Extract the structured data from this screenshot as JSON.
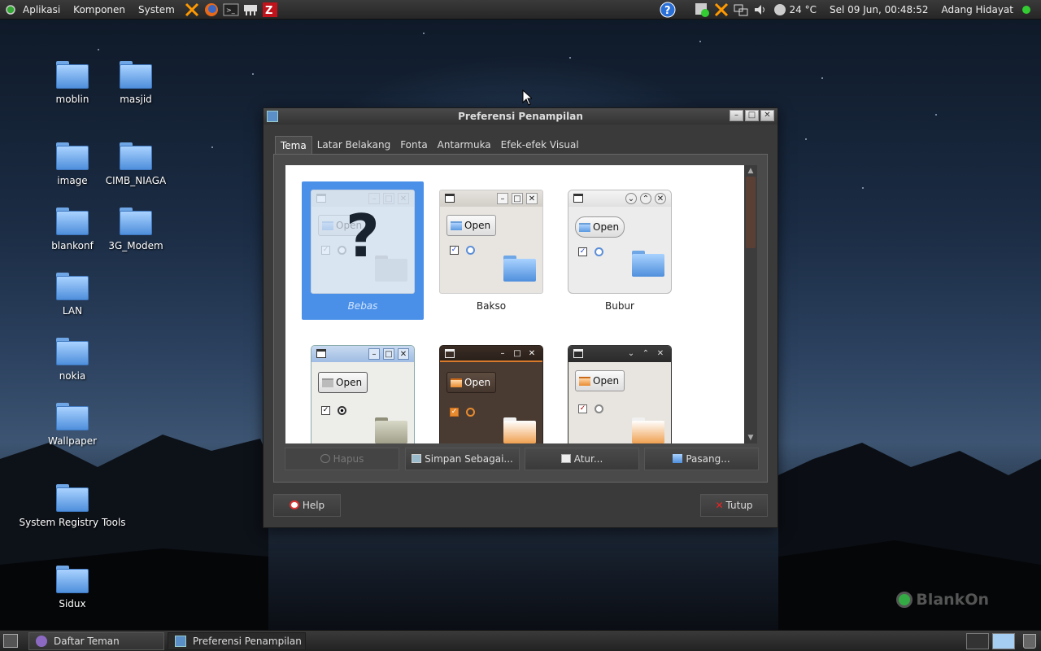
{
  "top_panel": {
    "menu": [
      "Aplikasi",
      "Komponen",
      "System"
    ],
    "launchers": [
      "tools-icon",
      "firefox-icon",
      "terminal-icon",
      "network-icon",
      "filezilla-icon"
    ],
    "temperature": "24 °C",
    "datetime": "Sel 09 Jun, 00:48:52",
    "user": "Adang Hidayat"
  },
  "desktop_icons": [
    {
      "label": "moblin"
    },
    {
      "label": "masjid"
    },
    {
      "label": "image"
    },
    {
      "label": "CIMB_NIAGA"
    },
    {
      "label": "blankonf"
    },
    {
      "label": "3G_Modem"
    },
    {
      "label": "LAN"
    },
    {
      "label": "nokia"
    },
    {
      "label": "Wallpaper"
    },
    {
      "label": "System Registry Tools"
    },
    {
      "label": "Sidux"
    }
  ],
  "dialog": {
    "title": "Preferensi Penampilan",
    "tabs": [
      "Tema",
      "Latar Belakang",
      "Fonta",
      "Antarmuka",
      "Efek-efek Visual"
    ],
    "active_tab": "Tema",
    "themes": [
      {
        "name": "Bebas",
        "selected": true
      },
      {
        "name": "Bakso",
        "selected": false
      },
      {
        "name": "Bubur",
        "selected": false
      },
      {
        "name": "",
        "selected": false
      },
      {
        "name": "",
        "selected": false
      },
      {
        "name": "",
        "selected": false
      }
    ],
    "preview_button": "Open",
    "buttons": {
      "delete": "Hapus",
      "save_as": "Simpan Sebagai...",
      "customize": "Atur...",
      "install": "Pasang..."
    },
    "help": "Help",
    "close": "Tutup"
  },
  "taskbar": {
    "tasks": [
      {
        "label": "Daftar Teman",
        "active": false
      },
      {
        "label": "Preferensi Penampilan",
        "active": true
      }
    ]
  },
  "branding": "BlankOn",
  "colors": {
    "selection": "#4a90e8",
    "panel": "#2e2e2e",
    "close_red": "#d22",
    "status_green": "#3c3"
  }
}
